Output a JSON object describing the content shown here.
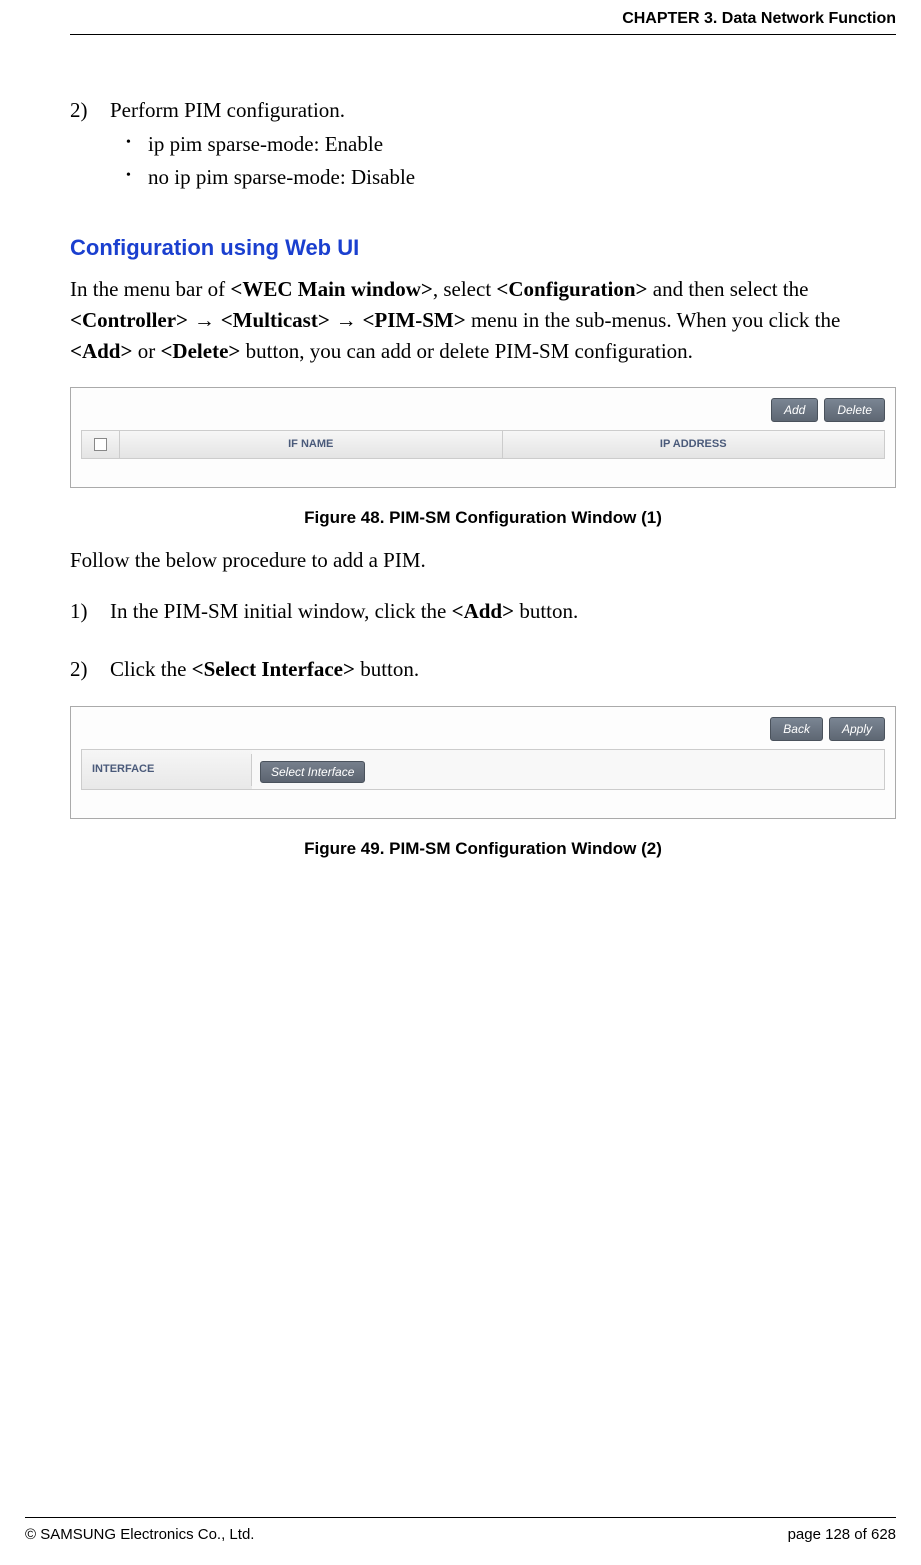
{
  "header": {
    "chapter": "CHAPTER 3. Data Network Function"
  },
  "step2": {
    "num": "2)",
    "text": "Perform PIM configuration.",
    "bullets": [
      "ip pim sparse-mode: Enable",
      "no ip pim sparse-mode: Disable"
    ]
  },
  "section_heading": "Configuration using Web UI",
  "intro": {
    "p1a": "In the menu bar of ",
    "b1": "<WEC Main window>",
    "p1b": ", select ",
    "b2": "<Configuration>",
    "p1c": " and then select the ",
    "b3": "<Controller>",
    "arr": " → ",
    "b4": "<Multicast>",
    "b5": "<PIM-SM>",
    "p1d": " menu in the sub-menus. When you click the ",
    "b6": "<Add>",
    "p1e": " or ",
    "b7": "<Delete>",
    "p1f": " button, you can add or delete PIM-SM configuration."
  },
  "fig48": {
    "add_btn": "Add",
    "delete_btn": "Delete",
    "col_name": "IF NAME",
    "col_addr": "IP ADDRESS",
    "caption": "Figure 48. PIM-SM Configuration Window (1)"
  },
  "follow_text": "Follow the below procedure to add a PIM.",
  "proc": {
    "s1num": "1)",
    "s1a": "In the PIM-SM initial window, click the ",
    "s1b": "<Add>",
    "s1c": " button.",
    "s2num": "2)",
    "s2a": "Click the ",
    "s2b": "<Select Interface>",
    "s2c": " button."
  },
  "fig49": {
    "back_btn": "Back",
    "apply_btn": "Apply",
    "label": "INTERFACE",
    "select_btn": "Select Interface",
    "caption": "Figure 49. PIM-SM Configuration Window (2)"
  },
  "footer": {
    "copyright": "© SAMSUNG Electronics Co., Ltd.",
    "page": "page 128 of 628"
  }
}
